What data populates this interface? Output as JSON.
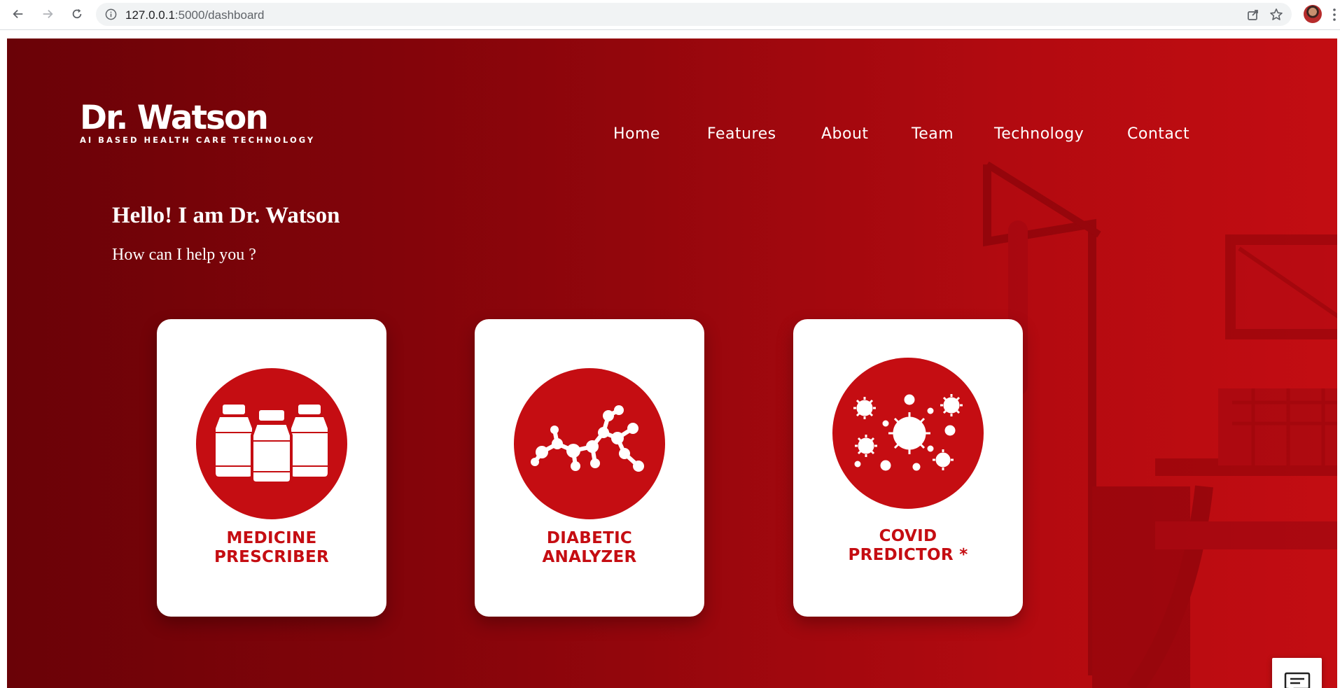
{
  "browser": {
    "url_host": "127.0.0.1",
    "url_path": ":5000/dashboard"
  },
  "brand": {
    "title": "Dr. Watson",
    "tagline": "AI BASED HEALTH CARE TECHNOLOGY"
  },
  "nav": {
    "items": [
      "Home",
      "Features",
      "About",
      "Team",
      "Technology",
      "Contact"
    ]
  },
  "hero": {
    "greeting": "Hello! I am Dr. Watson",
    "subgreeting": "How can I help you ?"
  },
  "cards": [
    {
      "line1": "MEDICINE",
      "line2": "PRESCRIBER",
      "icon": "medicine-bottles-icon"
    },
    {
      "line1": "DIABETIC",
      "line2": "ANALYZER",
      "icon": "molecule-icon"
    },
    {
      "line1": "COVID",
      "line2": "PREDICTOR *",
      "icon": "virus-icon"
    }
  ],
  "colors": {
    "accent": "#c50d12",
    "hero_dark": "#6a0207",
    "hero_light": "#c30d12"
  },
  "chat": {
    "icon": "chat-icon"
  }
}
